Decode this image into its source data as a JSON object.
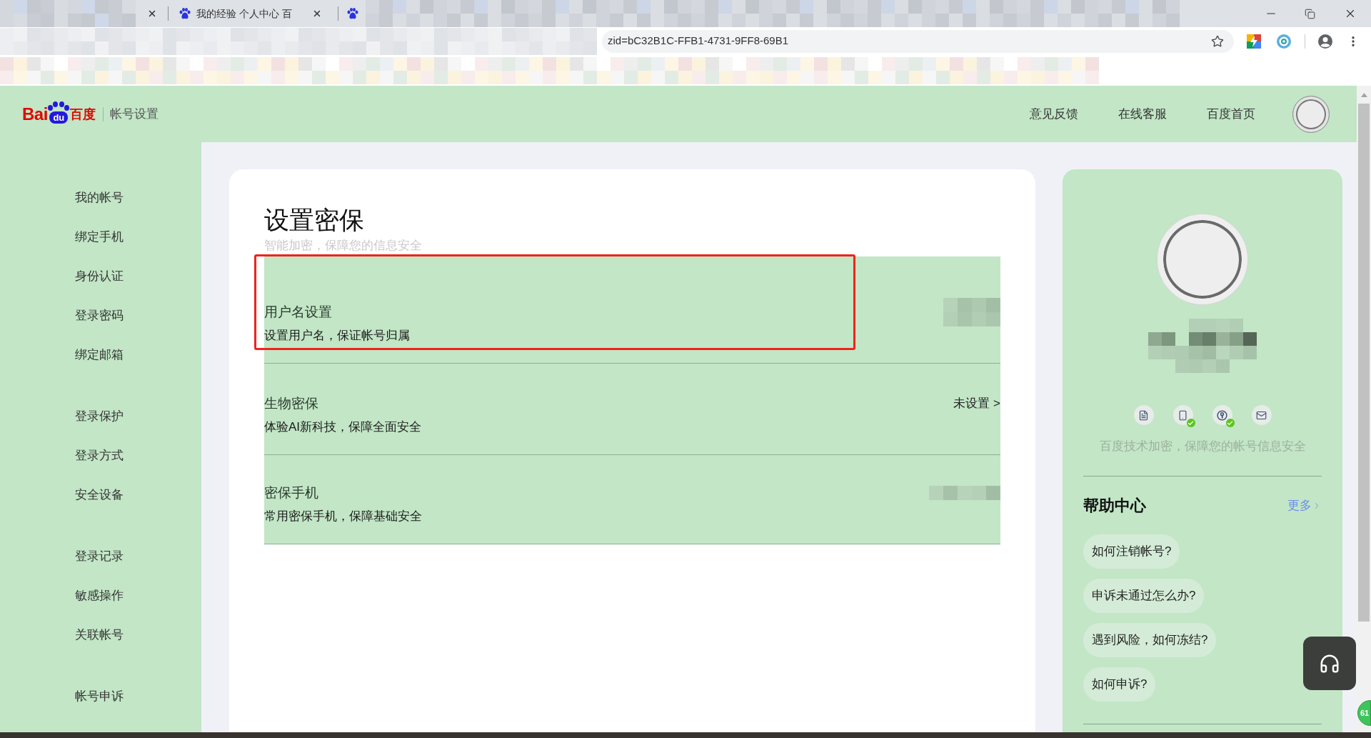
{
  "browser": {
    "tab_title": "我的经验 个人中心 百",
    "url": "zid=bC32B1C-FFB1-4731-9FF8-69B1"
  },
  "header": {
    "logo": {
      "left": "Bai",
      "mark": "du",
      "right": "百度"
    },
    "section": "帐号设置",
    "links": [
      "意见反馈",
      "在线客服",
      "百度首页"
    ]
  },
  "sidebar": {
    "groups": [
      {
        "items": [
          "我的帐号",
          "绑定手机",
          "身份认证",
          "登录密码",
          "绑定邮箱"
        ]
      },
      {
        "items": [
          "登录保护",
          "登录方式",
          "安全设备"
        ]
      },
      {
        "items": [
          "登录记录",
          "敏感操作",
          "关联帐号"
        ]
      },
      {
        "items": [
          "帐号申诉"
        ]
      }
    ]
  },
  "main": {
    "title": "设置密保",
    "subtitle": "智能加密，保障您的信息安全",
    "rows": [
      {
        "title": "用户名设置",
        "description": "设置用户名，保证帐号归属",
        "value": {
          "kind": "blurred"
        },
        "highlighted": true
      },
      {
        "title": "生物密保",
        "description": "体验AI新科技，保障全面安全",
        "value": {
          "kind": "text",
          "text": "未设置 >"
        },
        "highlighted": false
      },
      {
        "title": "密保手机",
        "description": "常用密保手机，保障基础安全",
        "value": {
          "kind": "blurred"
        },
        "highlighted": false
      }
    ]
  },
  "profile": {
    "security_icons": [
      {
        "kind": "document",
        "verified": false
      },
      {
        "kind": "phone",
        "verified": true
      },
      {
        "kind": "key",
        "verified": true
      },
      {
        "kind": "mail",
        "verified": false
      }
    ],
    "note": "百度技术加密，保障您的帐号信息安全"
  },
  "help": {
    "title": "帮助中心",
    "more": "更多",
    "questions": [
      "如何注销帐号?",
      "申诉未通过怎么办?",
      "遇到风险，如何冻结?",
      "如何申诉?"
    ]
  },
  "floating": {
    "badge": "61"
  }
}
